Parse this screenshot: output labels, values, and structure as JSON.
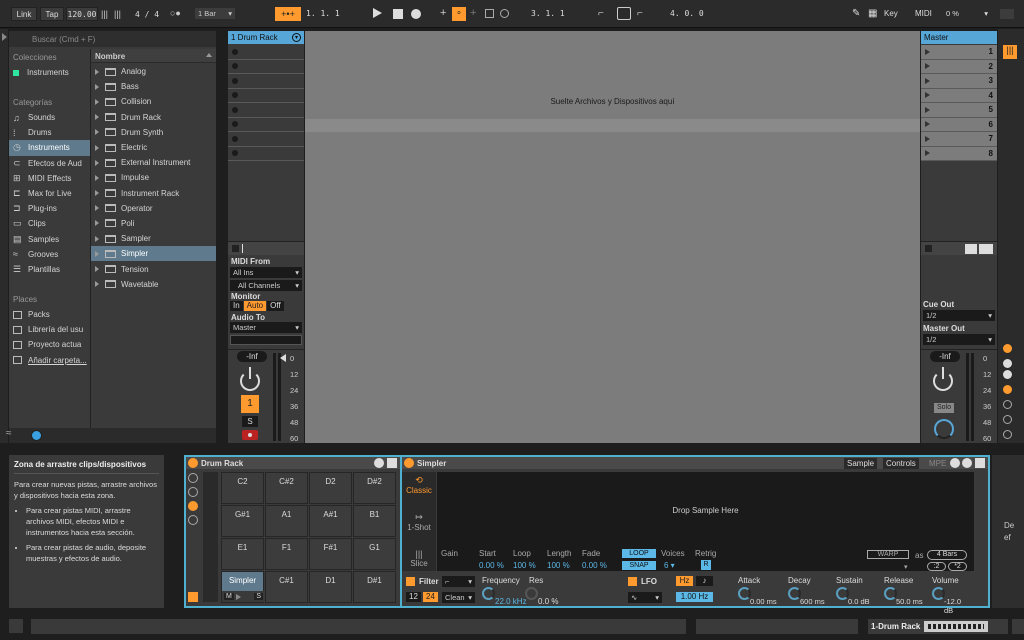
{
  "transport": {
    "link": "Link",
    "tap": "Tap",
    "tempo": "120.00",
    "sig": "4 / 4",
    "quant": "1 Bar",
    "pos": "1.   1.   1",
    "pos2": "3.   1.   1",
    "len": "4.   0.   0",
    "key": "Key",
    "midi": "MIDI",
    "cpu": "0 %"
  },
  "browser": {
    "search_placeholder": "Buscar (Cmd + F)",
    "collections_header": "Colecciones",
    "collections": [
      "Instruments"
    ],
    "categories_header": "Categorías",
    "categories": [
      "Sounds",
      "Drums",
      "Instruments",
      "Efectos de Aud",
      "MIDI Effects",
      "Max for Live",
      "Plug-ins",
      "Clips",
      "Samples",
      "Grooves",
      "Plantillas"
    ],
    "places_header": "Places",
    "places": [
      "Packs",
      "Librería del usu",
      "Proyecto actua",
      "Añadir carpeta..."
    ],
    "name_header": "Nombre",
    "items": [
      "Analog",
      "Bass",
      "Collision",
      "Drum Rack",
      "Drum Synth",
      "Electric",
      "External Instrument",
      "Impulse",
      "Instrument Rack",
      "Operator",
      "Poli",
      "Sampler",
      "Simpler",
      "Tension",
      "Wavetable"
    ]
  },
  "track": {
    "name": "1 Drum Rack",
    "midi_from": "MIDI From",
    "all_ins": "All Ins",
    "all_channels": "All Channels",
    "monitor": "Monitor",
    "mon_in": "In",
    "mon_auto": "Auto",
    "mon_off": "Off",
    "audio_to": "Audio To",
    "master": "Master",
    "vol": "-Inf",
    "num": "1",
    "solo": "S"
  },
  "drop_text": "Suelte Archivos y Dispositivos aquí",
  "master": {
    "name": "Master",
    "scenes": [
      "1",
      "2",
      "3",
      "4",
      "5",
      "6",
      "7",
      "8"
    ],
    "cue_out": "Cue Out",
    "cue_val": "1/2",
    "master_out": "Master Out",
    "master_val": "1/2",
    "vol": "-Inf",
    "solo": "Solo"
  },
  "meter_ticks": [
    "0",
    "12",
    "24",
    "36",
    "48",
    "60"
  ],
  "info": {
    "title": "Zona de arrastre clips/dispositivos",
    "intro": "Para crear nuevas pistas, arrastre archivos y dispositivos hacia esta zona.",
    "bullet1": "Para crear pistas MIDI, arrastre archivos MIDI, efectos MIDI e instrumentos hacia esta sección.",
    "bullet2": "Para crear pistas de audio, deposite muestras y efectos de audio."
  },
  "drumrack": {
    "title": "Drum Rack",
    "pads": [
      "C2",
      "C#2",
      "D2",
      "D#2",
      "G#1",
      "A1",
      "A#1",
      "B1",
      "E1",
      "F1",
      "F#1",
      "G1",
      "Simpler",
      "C#1",
      "D1",
      "D#1"
    ],
    "mute": "M",
    "solo": "S"
  },
  "simpler": {
    "title": "Simpler",
    "tab_sample": "Sample",
    "tab_controls": "Controls",
    "tab_mpe": "MPE",
    "modes": [
      "Classic",
      "1-Shot",
      "Slice"
    ],
    "drop": "Drop Sample Here",
    "params": [
      {
        "l": "Gain",
        "v": ""
      },
      {
        "l": "Start",
        "v": "0.00 %"
      },
      {
        "l": "Loop",
        "v": "100 %"
      },
      {
        "l": "Length",
        "v": "100 %"
      },
      {
        "l": "Fade",
        "v": "0.00 %"
      }
    ],
    "loop": "LOOP",
    "snap": "SNAP",
    "voices_label": "Voices",
    "voices": "6",
    "retrig": "Retrig",
    "retrig_val": "R",
    "warp": "WARP",
    "as": "as",
    "bars": "4 Bars",
    "div": ":2",
    "mul": "*2",
    "filter": "Filter",
    "f12": "12",
    "f24": "24",
    "clean": "Clean",
    "freq_label": "Frequency",
    "freq": "22.0 kHz",
    "res_label": "Res",
    "res": "0.0 %",
    "lfo": "LFO",
    "hz": "Hz",
    "lfo_rate": "1.00 Hz",
    "attack_label": "Attack",
    "attack": "0.00 ms",
    "decay_label": "Decay",
    "decay": "600 ms",
    "sustain_label": "Sustain",
    "sustain": "0.0 dB",
    "release_label": "Release",
    "release": "50.0 ms",
    "volume_label": "Volume",
    "volume": "-12.0 dB"
  },
  "status": {
    "track": "1-Drum Rack",
    "right_partial": "De\nef"
  }
}
